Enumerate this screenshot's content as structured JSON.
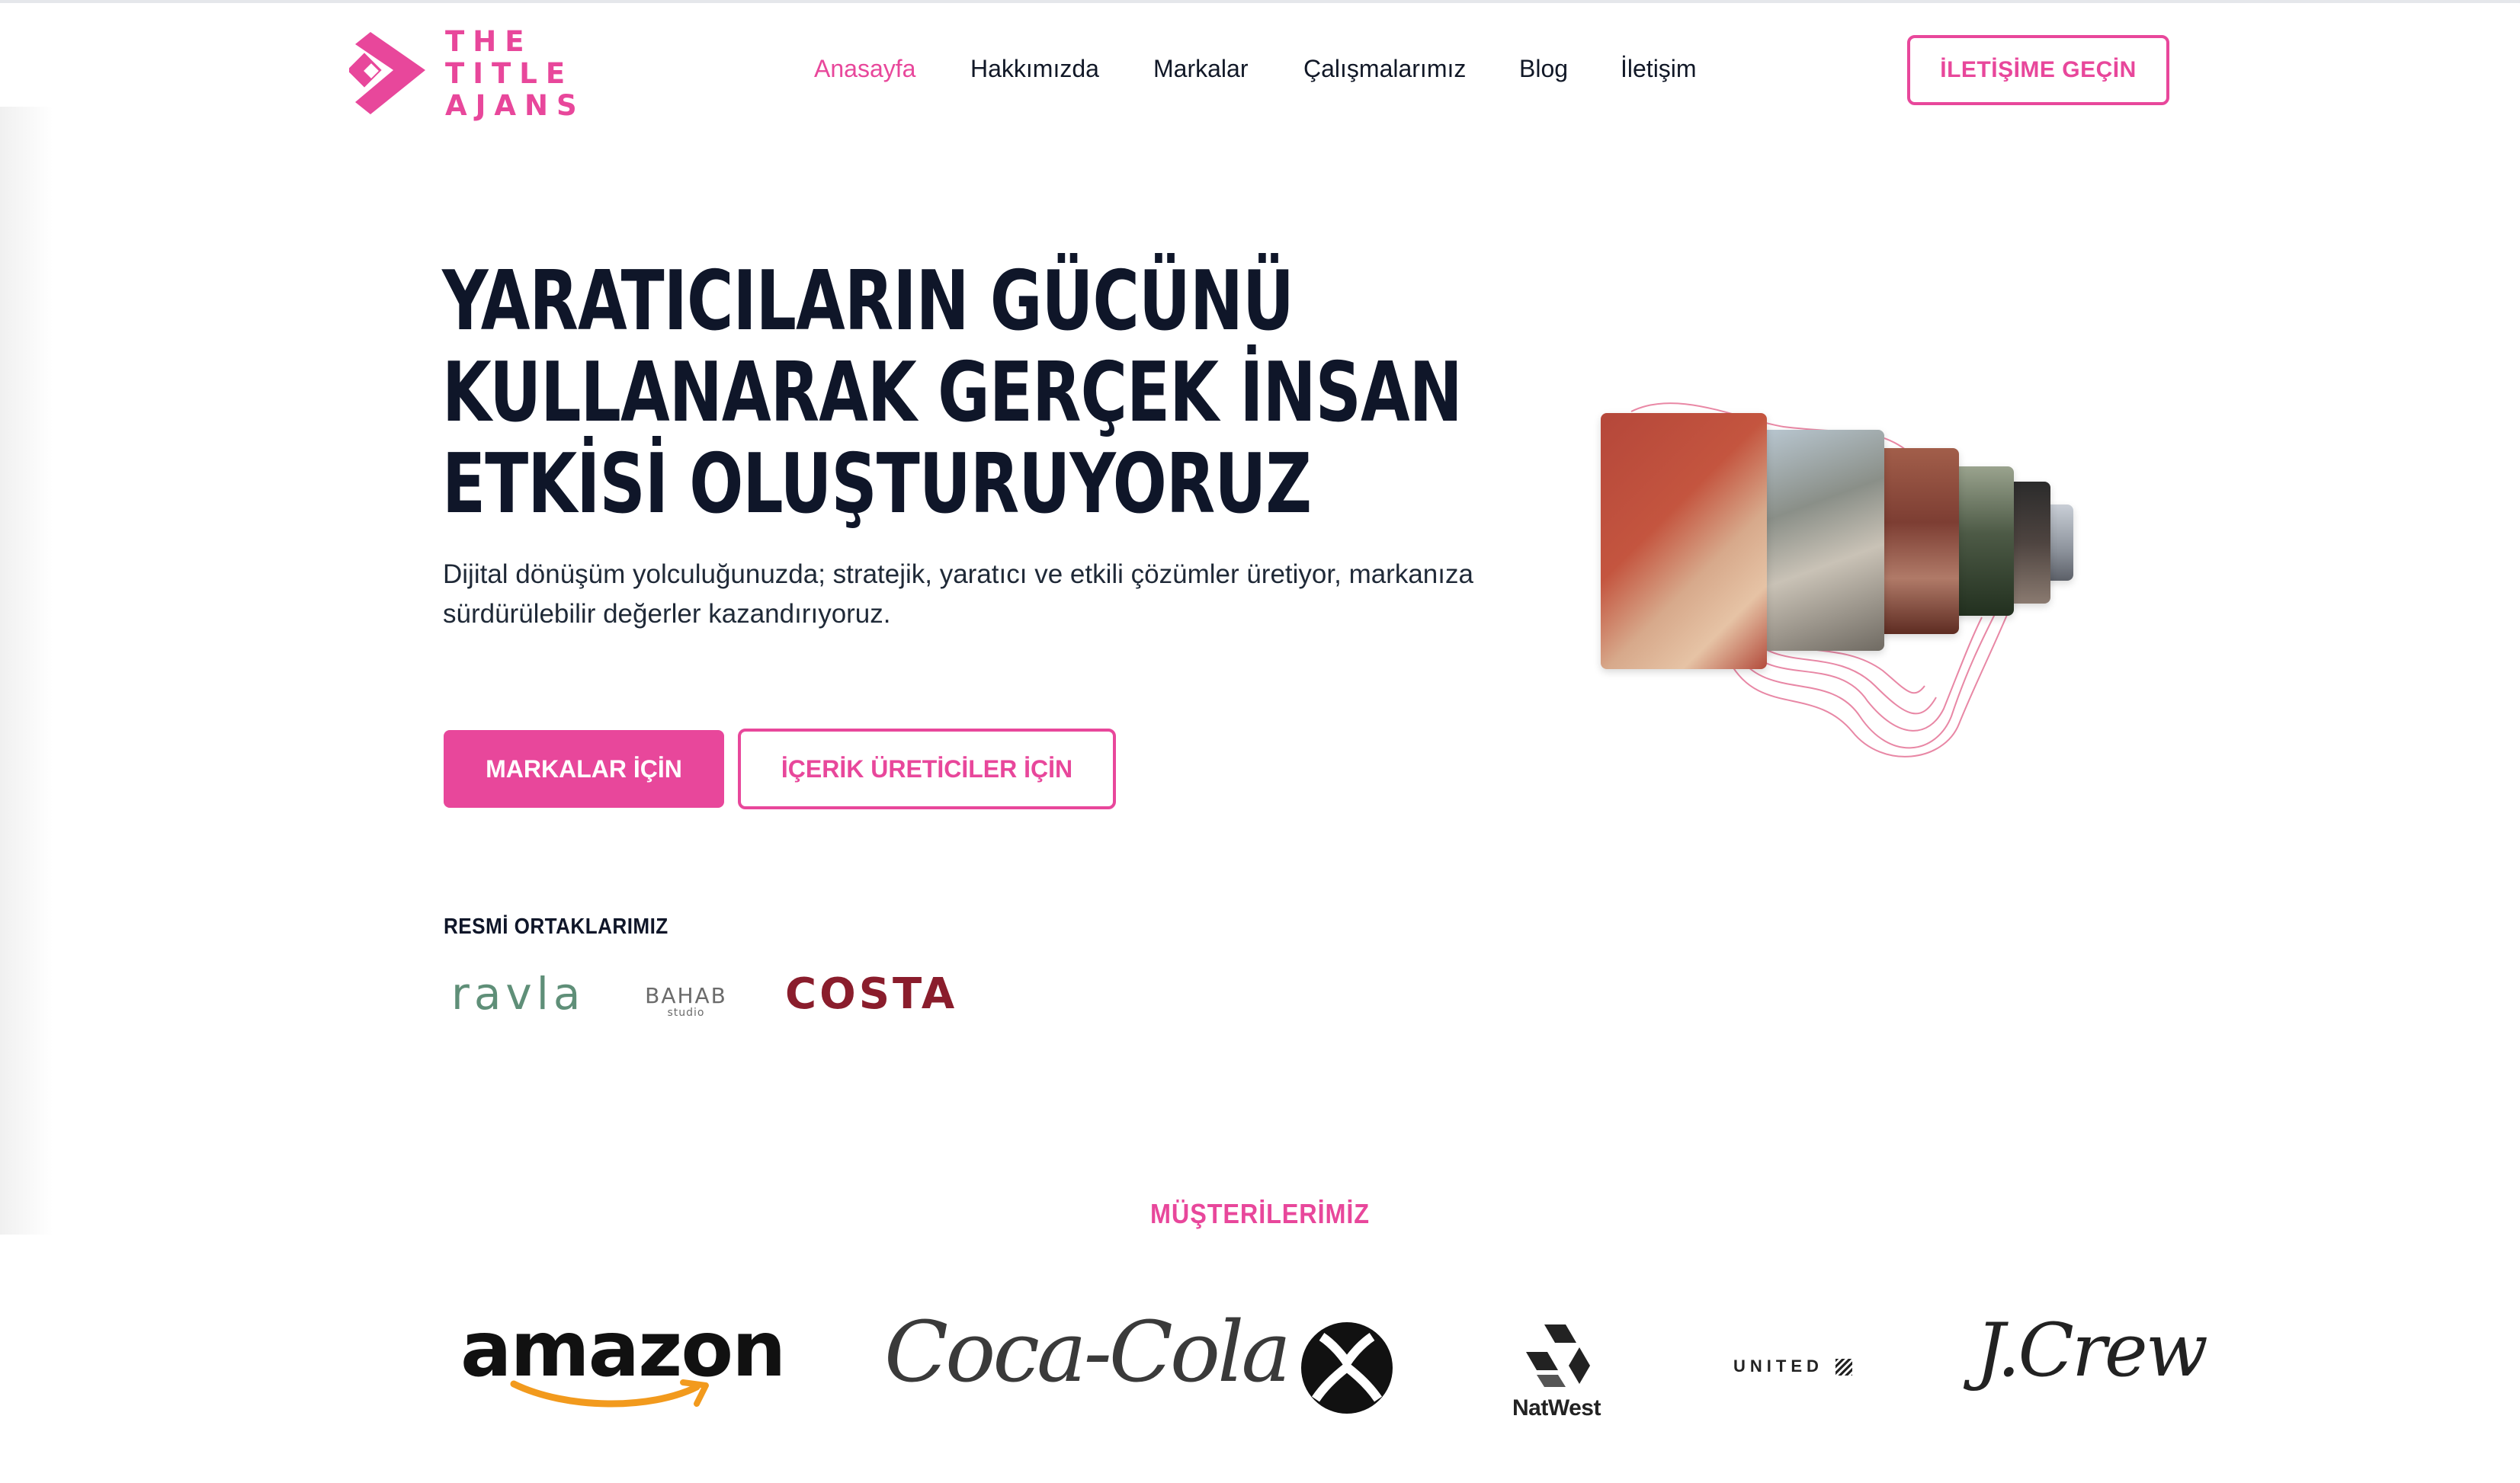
{
  "brand": {
    "logo_lines": [
      "THE",
      "TITLE",
      "AJANS"
    ],
    "accent_color": "#e8479b"
  },
  "nav": {
    "items": [
      {
        "label": "Anasayfa",
        "active": true
      },
      {
        "label": "Hakkımızda",
        "active": false
      },
      {
        "label": "Markalar",
        "active": false
      },
      {
        "label": "Çalışmalarımız",
        "active": false
      },
      {
        "label": "Blog",
        "active": false
      },
      {
        "label": "İletişim",
        "active": false
      }
    ],
    "cta_label": "İLETİŞİME GEÇİN"
  },
  "hero": {
    "title_lines": [
      "YARATICILARIN GÜCÜNÜ",
      "KULLANARAK GERÇEK İNSAN",
      "ETKİSİ OLUŞTURUYORUZ"
    ],
    "subtitle": "Dijital dönüşüm yolculuğunuzda; stratejik, yaratıcı ve etkili çözümler üretiyor, markanıza sürdürülebilir değerler kazandırıyoruz.",
    "primary_button": "MARKALAR İÇİN",
    "secondary_button": "İÇERİK ÜRETİCİLER İÇİN"
  },
  "partners": {
    "title": "RESMİ ORTAKLARIMIZ",
    "logos": {
      "ravla": "ravla",
      "bahab": "BAHAB",
      "bahab_sub": "studio",
      "costa": "COSTA"
    }
  },
  "clients": {
    "title": "MÜŞTERİLERİMİZ",
    "logos": {
      "amazon": "amazon",
      "cocacola": "Coca-Cola",
      "xbox_icon": "xbox-logo-icon",
      "natwest": "NatWest",
      "united": "UNITED",
      "jcrew": "J.Crew"
    }
  }
}
